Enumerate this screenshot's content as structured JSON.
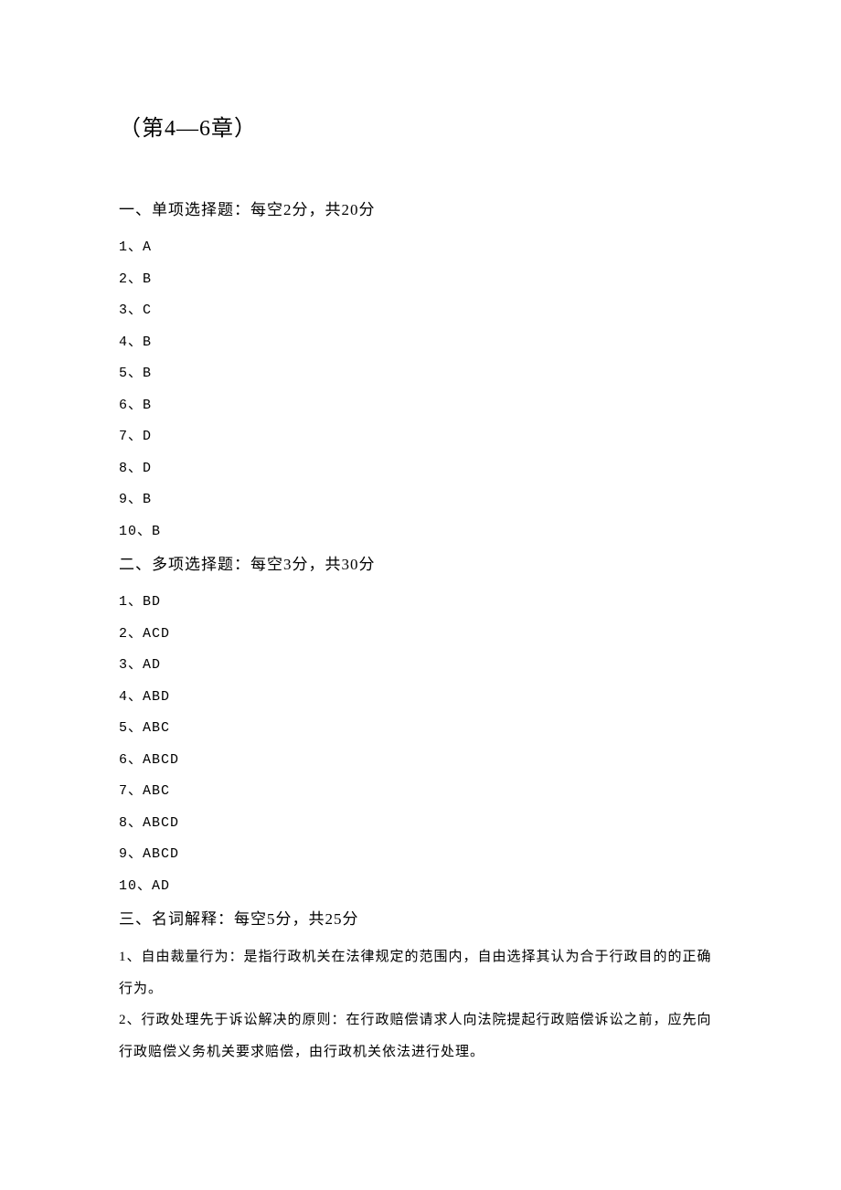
{
  "title": "（第4—6章）",
  "sections": [
    {
      "heading": "一、单项选择题：每空2分，共20分",
      "answers": [
        "1、A",
        "2、B",
        "3、C",
        "4、B",
        "5、B",
        "6、B",
        "7、D",
        "8、D",
        "9、B",
        "10、B"
      ]
    },
    {
      "heading": "二、多项选择题：每空3分，共30分",
      "answers": [
        "1、BD",
        "2、ACD",
        "3、AD",
        "4、ABD",
        "5、ABC",
        "6、ABCD",
        "7、ABC",
        "8、ABCD",
        "9、ABCD",
        "10、AD"
      ]
    },
    {
      "heading": "三、名词解释：每空5分，共25分",
      "terms": [
        "1、自由裁量行为：是指行政机关在法律规定的范围内，自由选择其认为合于行政目的的正确行为。",
        "2、行政处理先于诉讼解决的原则：在行政赔偿请求人向法院提起行政赔偿诉讼之前，应先向行政赔偿义务机关要求赔偿，由行政机关依法进行处理。"
      ]
    }
  ]
}
